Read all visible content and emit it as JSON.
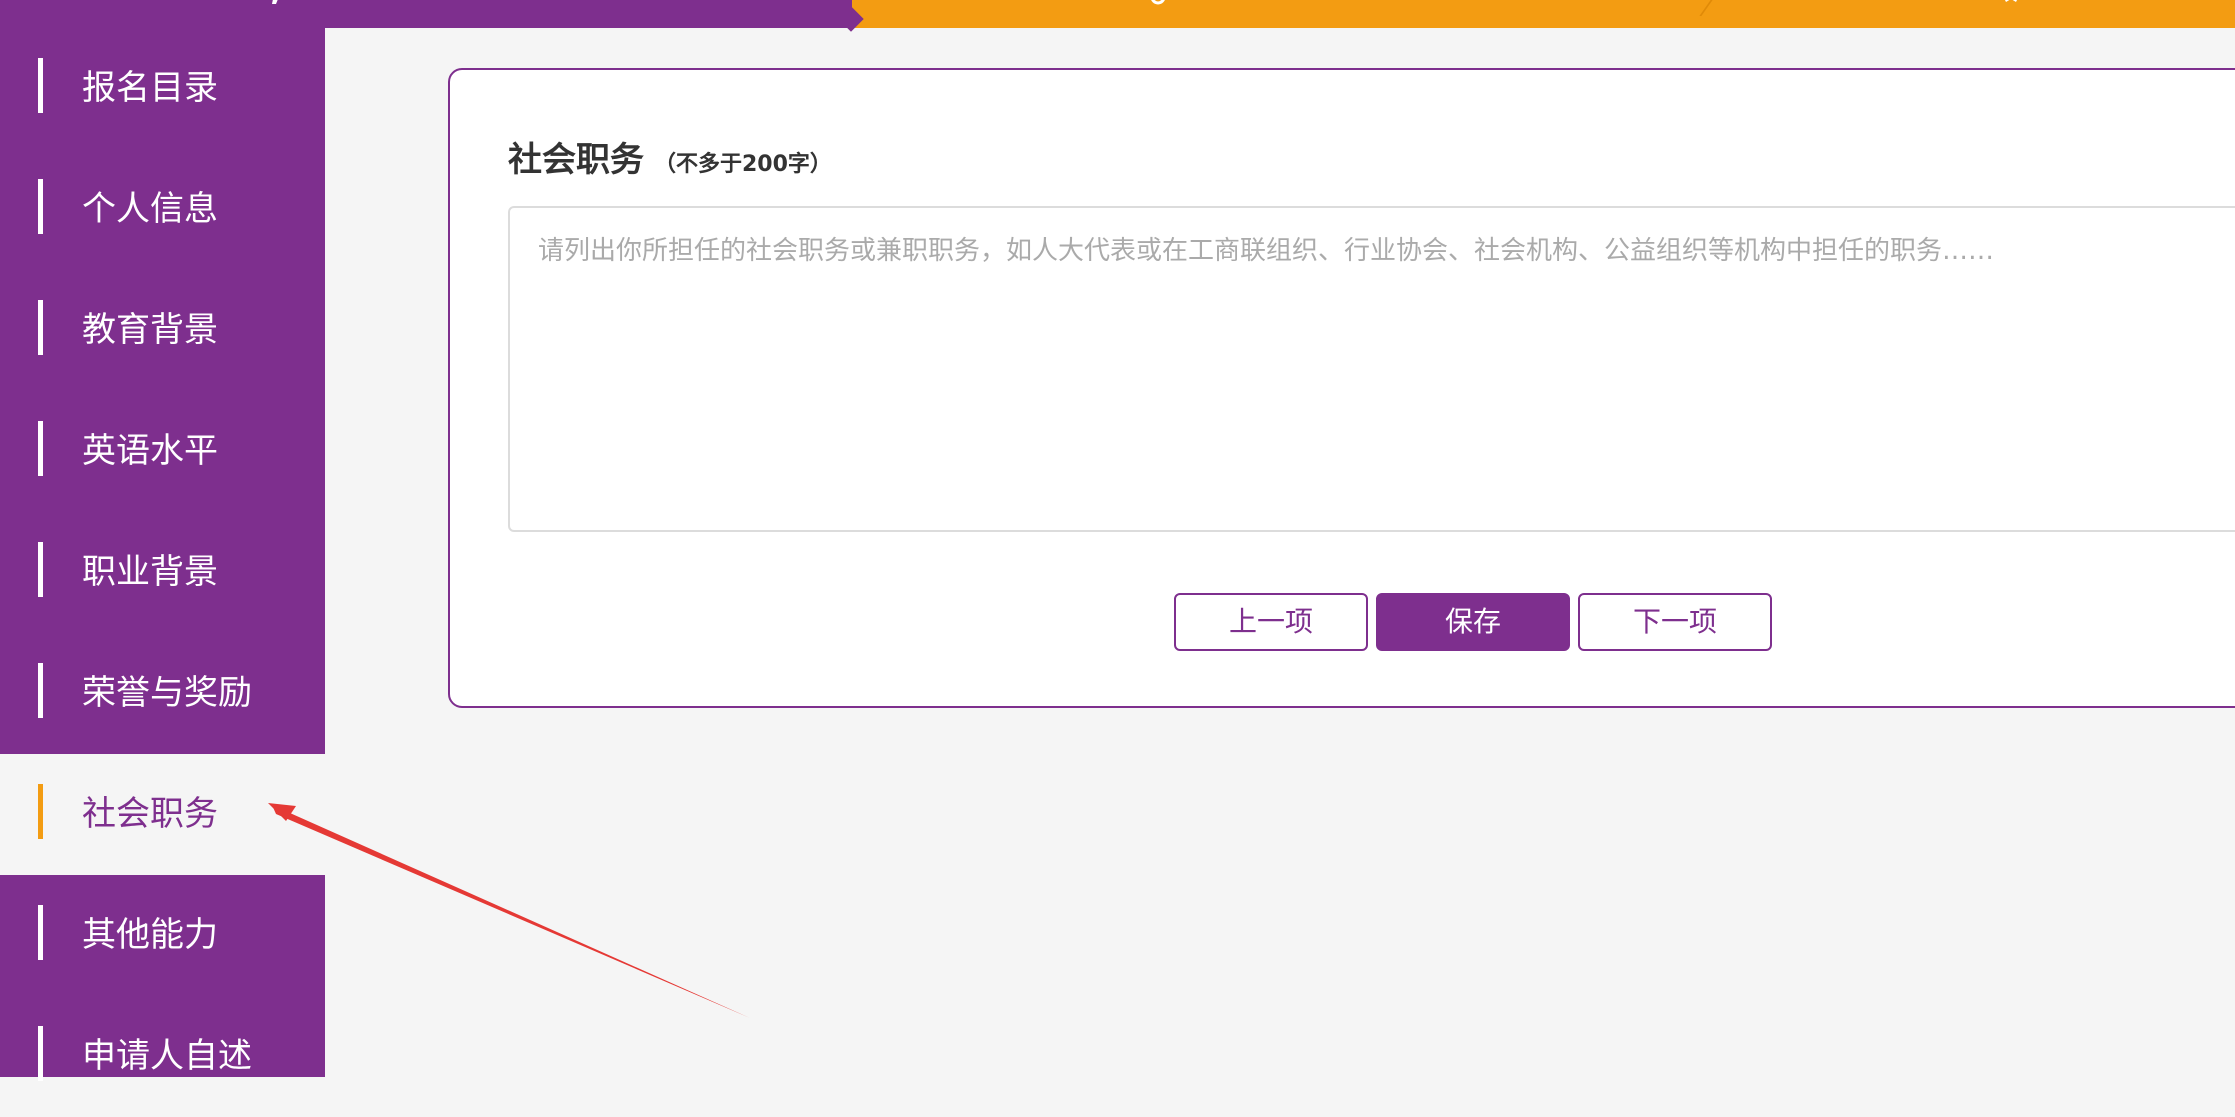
{
  "colors": {
    "brand": "#7e2f8e",
    "accent": "#f39c12",
    "page_bg": "#f5f5f5",
    "annotation": "#e53935"
  },
  "stepbar": {
    "icons": [
      "pencil-icon",
      "search-icon",
      "star-icon"
    ]
  },
  "sidebar": {
    "items": [
      {
        "label": "报名目录",
        "active": false
      },
      {
        "label": "个人信息",
        "active": false
      },
      {
        "label": "教育背景",
        "active": false
      },
      {
        "label": "英语水平",
        "active": false
      },
      {
        "label": "职业背景",
        "active": false
      },
      {
        "label": "荣誉与奖励",
        "active": false
      },
      {
        "label": "社会职务",
        "active": true
      },
      {
        "label": "其他能力",
        "active": false
      },
      {
        "label": "申请人自述",
        "active": false
      }
    ]
  },
  "form": {
    "title": "社会职务",
    "title_note": "（不多于200字）",
    "textarea": {
      "value": "",
      "placeholder": "请列出你所担任的社会职务或兼职职务，如人大代表或在工商联组织、行业协会、社会机构、公益组织等机构中担任的职务……"
    },
    "buttons": {
      "prev": "上一项",
      "save": "保存",
      "next": "下一项"
    }
  }
}
